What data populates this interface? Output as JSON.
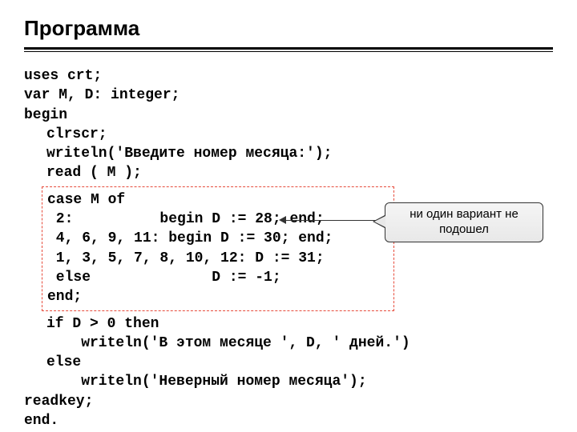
{
  "title": "Программа",
  "code": {
    "l1": "uses crt;",
    "l2": "var M, D: integer;",
    "l3": "begin",
    "l4": "clrscr;",
    "l5": "writeln('Введите номер месяца:');",
    "l6": "read ( M );",
    "case1": "case M of",
    "case2": " 2:          begin D := 28; end;",
    "case3": " 4, 6, 9, 11: begin D := 30; end;",
    "case4": " 1, 3, 5, 7, 8, 10, 12: D := 31;",
    "case5": " else              D := -1;",
    "case6": "end;",
    "l7": "if D > 0 then",
    "l8": "    writeln('В этом месяце ', D, ' дней.')",
    "l9": "else",
    "l10": "    writeln('Неверный номер месяца');",
    "l11": "readkey;",
    "l12": "end."
  },
  "callout": {
    "line1": "ни один вариант не",
    "line2": "подошел"
  }
}
